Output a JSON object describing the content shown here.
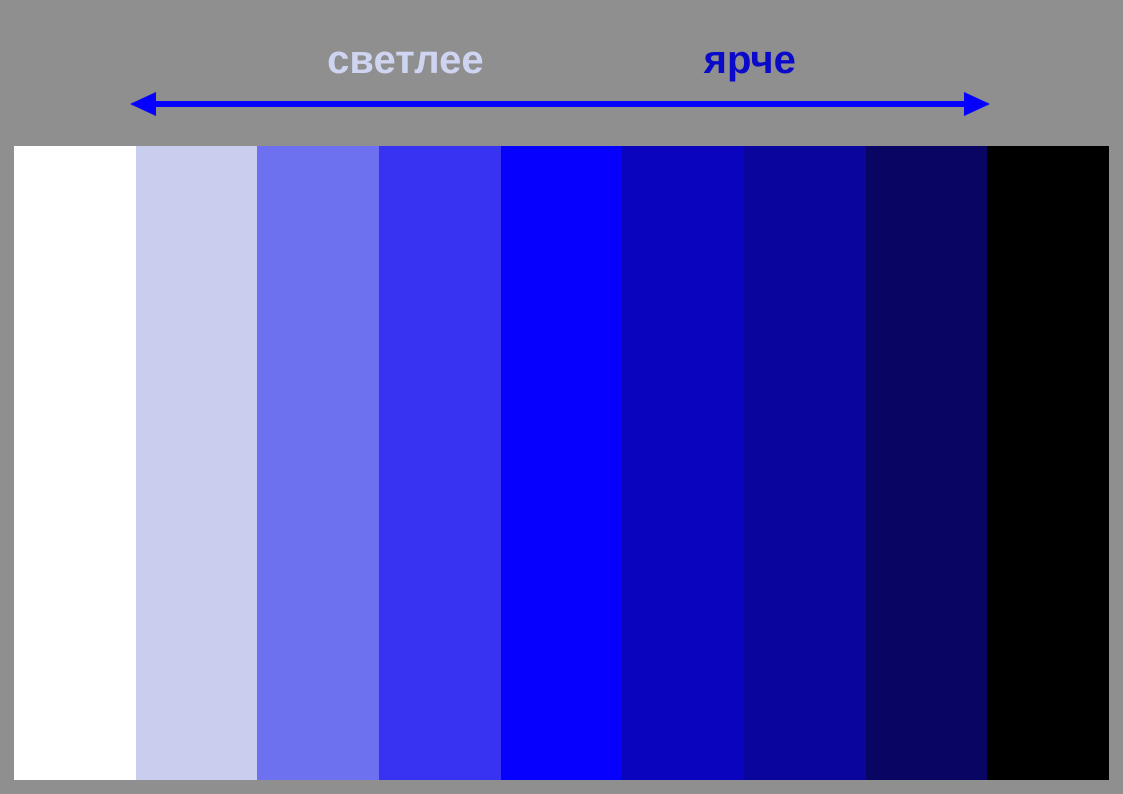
{
  "labels": {
    "left": "светлее",
    "right": "ярче"
  },
  "arrow_color": "#0600ff",
  "swatches": [
    {
      "name": "white",
      "hex": "#ffffff"
    },
    {
      "name": "lavender",
      "hex": "#c9ceef"
    },
    {
      "name": "light-blue",
      "hex": "#6d71f0"
    },
    {
      "name": "royal-blue",
      "hex": "#3833f1"
    },
    {
      "name": "blue",
      "hex": "#0600ff"
    },
    {
      "name": "dark-blue-1",
      "hex": "#0b04be"
    },
    {
      "name": "dark-blue-2",
      "hex": "#0a069d"
    },
    {
      "name": "navy",
      "hex": "#080563"
    },
    {
      "name": "black",
      "hex": "#000000"
    }
  ]
}
